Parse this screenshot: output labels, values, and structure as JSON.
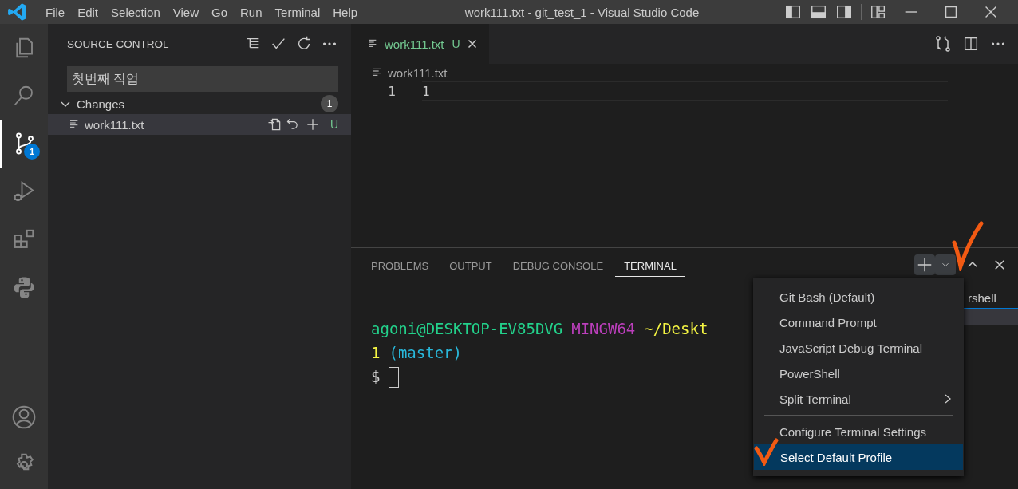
{
  "window": {
    "title": "work111.txt - git_test_1 - Visual Studio Code"
  },
  "menubar": [
    "File",
    "Edit",
    "Selection",
    "View",
    "Go",
    "Run",
    "Terminal",
    "Help"
  ],
  "activity_bar": [
    {
      "kind": "files",
      "selected": false
    },
    {
      "kind": "search",
      "selected": false
    },
    {
      "kind": "source-control",
      "selected": true,
      "badge": "1"
    },
    {
      "kind": "run-debug",
      "selected": false
    },
    {
      "kind": "extensions",
      "selected": false
    },
    {
      "kind": "python",
      "selected": false
    }
  ],
  "activity_bar_bottom": [
    {
      "kind": "account"
    },
    {
      "kind": "settings"
    }
  ],
  "sidebar": {
    "title": "SOURCE CONTROL",
    "commit_message": "첫번째 작업",
    "changes": {
      "label": "Changes",
      "count": "1",
      "expanded": true,
      "files": [
        {
          "name": "work111.txt",
          "status": "U",
          "selected": true
        }
      ]
    }
  },
  "editor": {
    "tabs": [
      {
        "label": "work111.txt",
        "status": "U",
        "selected": true
      }
    ],
    "breadcrumb": "work111.txt",
    "lines": [
      {
        "number": "1",
        "text": "1"
      }
    ]
  },
  "panel": {
    "tabs": [
      {
        "label": "PROBLEMS",
        "selected": false
      },
      {
        "label": "OUTPUT",
        "selected": false
      },
      {
        "label": "DEBUG CONSOLE",
        "selected": false
      },
      {
        "label": "TERMINAL",
        "selected": true
      }
    ],
    "terminal_lines": [
      [
        {
          "text": "agoni@DESKTOP-EV85DVG",
          "color": "#23d18b"
        },
        {
          "text": "MINGW64",
          "color": "#bc3fbc"
        },
        {
          "text": "~/Deskt",
          "color": "#f5f543"
        }
      ],
      [
        {
          "text": "1",
          "color": "#f5f543"
        },
        {
          "text": "(master)",
          "color": "#29b8db"
        }
      ],
      [
        {
          "text": "$",
          "color": "#cccccc"
        }
      ]
    ],
    "terminal_list": [
      {
        "label": "rshell",
        "selected": false
      },
      {
        "selected": true
      }
    ],
    "profile_menu": [
      {
        "kind": "item",
        "label": "Git Bash (Default)",
        "selected": false
      },
      {
        "kind": "item",
        "label": "Command Prompt",
        "selected": false
      },
      {
        "kind": "item",
        "label": "JavaScript Debug Terminal",
        "selected": false
      },
      {
        "kind": "item",
        "label": "PowerShell",
        "selected": false
      },
      {
        "kind": "submenu",
        "label": "Split Terminal",
        "selected": false
      },
      {
        "kind": "separator"
      },
      {
        "kind": "item",
        "label": "Configure Terminal Settings",
        "selected": false
      },
      {
        "kind": "item",
        "label": "Select Default Profile",
        "selected": true
      }
    ]
  }
}
